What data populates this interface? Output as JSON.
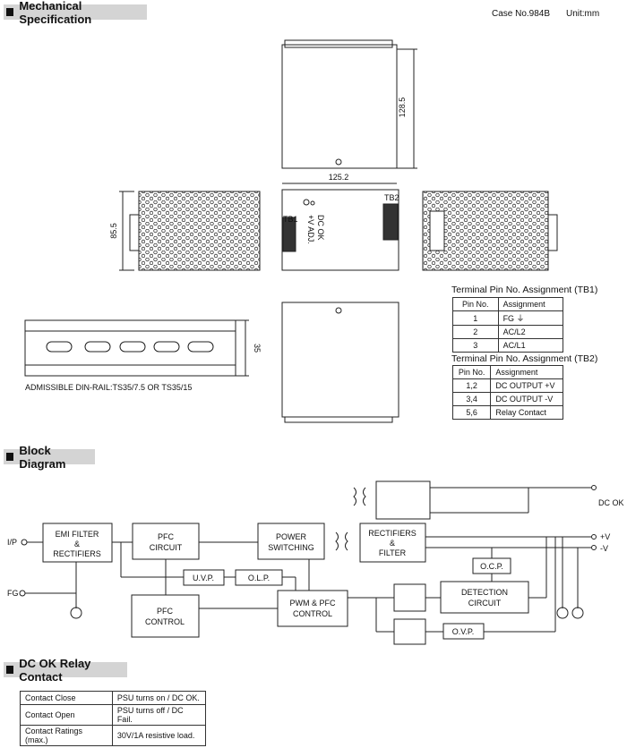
{
  "mech": {
    "title": "Mechanical Specification",
    "case_no": "Case No.984B",
    "unit": "Unit:mm",
    "dim_height": "128.5",
    "dim_width": "125.2",
    "dim_depth": "85.5",
    "dim_rail": "35",
    "tb1": "TB1",
    "tb2": "TB2",
    "dc_ok": "DC OK",
    "vadj": "+V ADJ.",
    "din_rail_note": "ADMISSIBLE DIN-RAIL:TS35/7.5 OR TS35/15",
    "tb1_table": {
      "title": "Terminal Pin No.  Assignment (TB1)",
      "headers": [
        "Pin No.",
        "Assignment"
      ],
      "rows": [
        [
          "1",
          "FG ⏚"
        ],
        [
          "2",
          "AC/L2"
        ],
        [
          "3",
          "AC/L1"
        ]
      ]
    },
    "tb2_table": {
      "title": "Terminal Pin No.  Assignment (TB2)",
      "headers": [
        "Pin No.",
        "Assignment"
      ],
      "rows": [
        [
          "1,2",
          "DC OUTPUT +V"
        ],
        [
          "3,4",
          "DC OUTPUT -V"
        ],
        [
          "5,6",
          "Relay Contact"
        ]
      ]
    }
  },
  "block": {
    "title": "Block Diagram",
    "ip": "I/P",
    "fg": "FG",
    "emi": [
      "EMI FILTER",
      "&",
      "RECTIFIERS"
    ],
    "pfc": [
      "PFC",
      "CIRCUIT"
    ],
    "psw": [
      "POWER",
      "SWITCHING"
    ],
    "rect": [
      "RECTIFIERS",
      "&",
      "FILTER"
    ],
    "uvp": "U.V.P.",
    "olp": "O.L.P.",
    "pfcc": [
      "PFC",
      "CONTROL"
    ],
    "pwm": [
      "PWM & PFC",
      "CONTROL"
    ],
    "ocp": "O.C.P.",
    "det": [
      "DETECTION",
      "CIRCUIT"
    ],
    "ovp": "O.V.P.",
    "dcok": "DC OK",
    "vp": "+V",
    "vm": "-V"
  },
  "relay": {
    "title": "DC OK Relay Contact",
    "rows": [
      [
        "Contact Close",
        "PSU turns on / DC OK."
      ],
      [
        "Contact Open",
        "PSU turns off / DC Fail."
      ],
      [
        "Contact Ratings (max.)",
        "30V/1A resistive load."
      ]
    ]
  }
}
